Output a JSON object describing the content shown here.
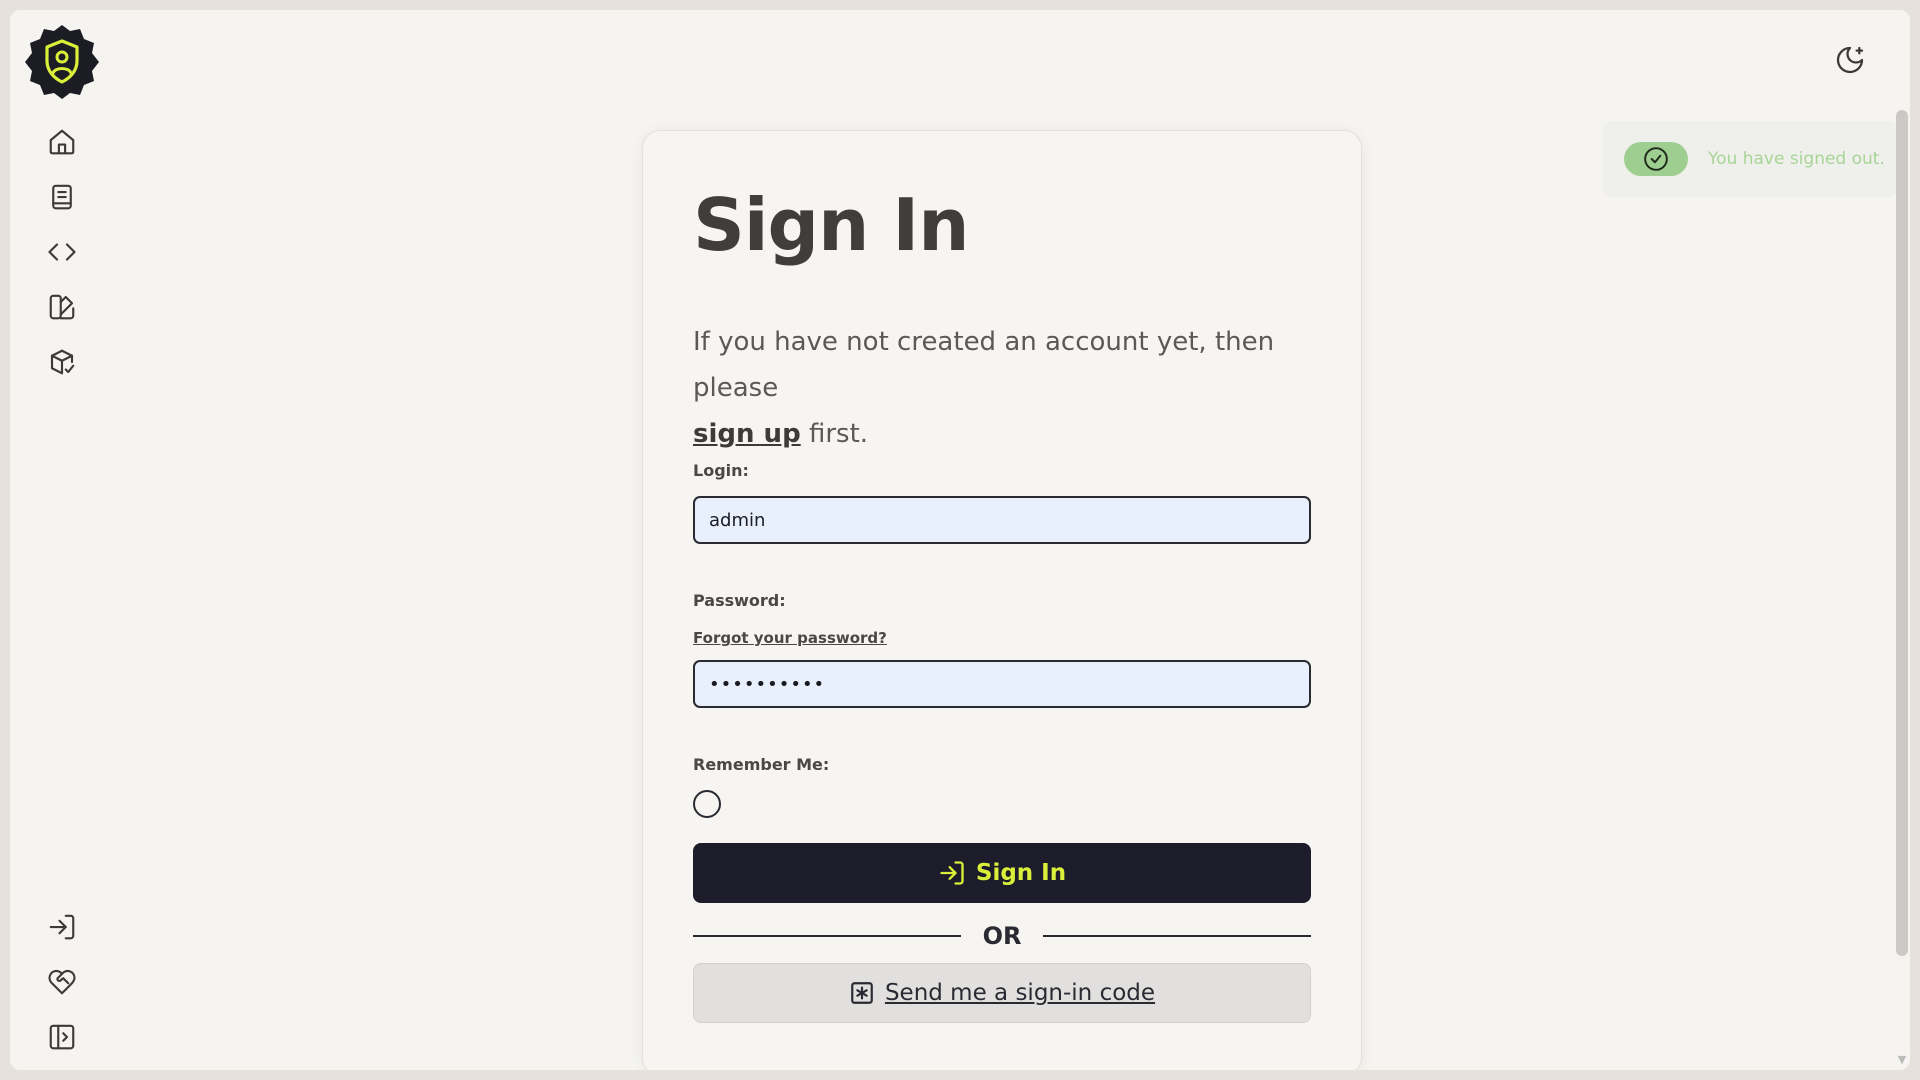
{
  "sidebar": {
    "logo_icon": "shield-user-icon",
    "top_items": [
      {
        "icon": "home-icon"
      },
      {
        "icon": "book-icon"
      },
      {
        "icon": "code-icon"
      },
      {
        "icon": "palette-icon"
      },
      {
        "icon": "package-check-icon"
      }
    ],
    "bottom_items": [
      {
        "icon": "sign-in-icon"
      },
      {
        "icon": "heart-handshake-icon"
      },
      {
        "icon": "sidebar-expand-icon"
      }
    ]
  },
  "header": {
    "theme_icon": "moon-star-icon"
  },
  "toast": {
    "message": "You have signed out.",
    "icon": "check-circle-icon",
    "color": "#9fcf90"
  },
  "form": {
    "title": "Sign In",
    "intro_prefix": "If you have not created an account yet, then please",
    "signup_link": "sign up",
    "intro_suffix": " first.",
    "login_label": "Login:",
    "login_value": "admin",
    "password_label": "Password:",
    "forgot_link": "Forgot your password?",
    "password_value": "••••••••••",
    "remember_label": "Remember Me:",
    "submit_label": "Sign In",
    "or_text": "OR",
    "code_button_label": "Send me a sign-in code"
  },
  "colors": {
    "accent": "#d9ef3a",
    "primary_button": "#1c1c2a"
  }
}
